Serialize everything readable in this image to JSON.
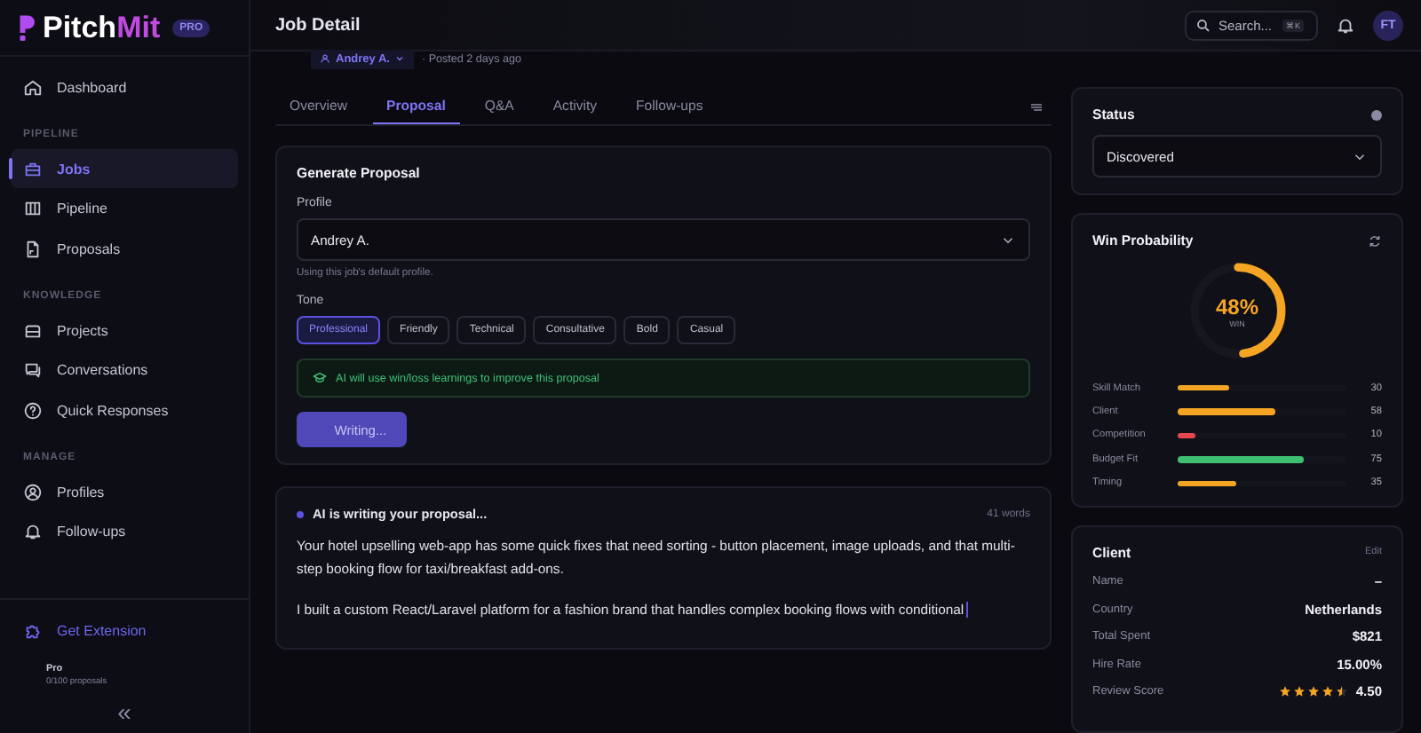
{
  "brand": {
    "name_a": "Pitch",
    "name_b": "Mit",
    "badge": "PRO"
  },
  "sidebar": {
    "sections": [
      {
        "items": [
          {
            "label": "Dashboard",
            "selected": false
          }
        ]
      },
      {
        "heading": "PIPELINE",
        "items": [
          {
            "label": "Jobs",
            "selected": true
          },
          {
            "label": "Pipeline",
            "selected": false
          },
          {
            "label": "Proposals",
            "selected": false
          }
        ]
      },
      {
        "heading": "KNOWLEDGE",
        "items": [
          {
            "label": "Projects",
            "selected": false
          },
          {
            "label": "Conversations",
            "selected": false
          },
          {
            "label": "Quick Responses",
            "selected": false
          }
        ]
      },
      {
        "heading": "MANAGE",
        "items": [
          {
            "label": "Profiles",
            "selected": false
          },
          {
            "label": "Follow-ups",
            "selected": false
          }
        ]
      }
    ],
    "extension": "Get Extension",
    "plan": "Pro",
    "usage": "0/100 proposals",
    "collapse": "«"
  },
  "header": {
    "title": "Job Detail",
    "search_placeholder": "Search...",
    "shortcut": "⌘K",
    "avatar": "FT"
  },
  "job_meta": {
    "profile": "Andrey A.",
    "posted": "· Posted 2 days ago"
  },
  "tabs": [
    {
      "label": "Overview",
      "selected": false
    },
    {
      "label": "Proposal",
      "selected": true
    },
    {
      "label": "Q&A",
      "selected": false
    },
    {
      "label": "Activity",
      "selected": false
    },
    {
      "label": "Follow-ups",
      "selected": false
    }
  ],
  "generate": {
    "title": "Generate Proposal",
    "profile_label": "Profile",
    "profile_value": "Andrey A.",
    "profile_hint": "Using this job's default profile.",
    "tone_label": "Tone",
    "tones": [
      {
        "label": "Professional",
        "selected": true
      },
      {
        "label": "Friendly",
        "selected": false
      },
      {
        "label": "Technical",
        "selected": false
      },
      {
        "label": "Consultative",
        "selected": false
      },
      {
        "label": "Bold",
        "selected": false
      },
      {
        "label": "Casual",
        "selected": false
      }
    ],
    "notice": "AI will use win/loss learnings to improve this proposal",
    "button": "Writing..."
  },
  "writing": {
    "title": "AI is writing your proposal...",
    "count": "41 words",
    "paragraphs": [
      "Your hotel upselling web-app has some quick fixes that need sorting - button placement, image uploads, and that multi-step booking flow for taxi/breakfast add-ons.",
      "I built a custom React/Laravel platform for a fashion brand that handles complex booking flows with conditional"
    ]
  },
  "status": {
    "title": "Status",
    "value": "Discovered"
  },
  "win": {
    "title": "Win Probability",
    "percent": "48%",
    "caption": "WIN",
    "level": 0.48,
    "factors": [
      {
        "name": "Skill Match",
        "level": 0.3,
        "value": "30",
        "color": "#f5a524"
      },
      {
        "name": "Client",
        "level": 0.58,
        "value": "58",
        "color": "#f5a524"
      },
      {
        "name": "Competition",
        "level": 0.1,
        "value": "10",
        "color": "#e5484d"
      },
      {
        "name": "Budget Fit",
        "level": 0.75,
        "value": "75",
        "color": "#3fbf72"
      },
      {
        "name": "Timing",
        "level": 0.35,
        "value": "35",
        "color": "#f5a524"
      }
    ]
  },
  "client": {
    "title": "Client",
    "edit": "Edit",
    "rows": [
      {
        "label": "Name",
        "value": "–"
      },
      {
        "label": "Country",
        "value": "Netherlands"
      },
      {
        "label": "Total Spent",
        "value": "$821"
      },
      {
        "label": "Hire Rate",
        "value": "15.00%"
      }
    ],
    "review": {
      "label": "Review Score",
      "stars": 4.5,
      "value": "4.50"
    }
  }
}
